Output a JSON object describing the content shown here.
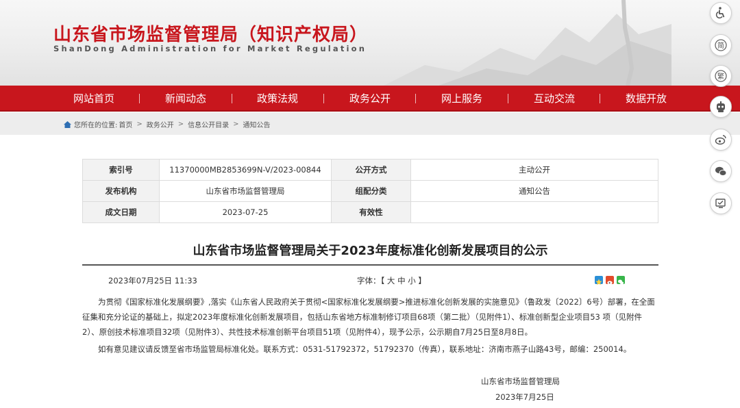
{
  "header": {
    "title": "山东省市场监督管理局（知识产权局）",
    "subtitle": "ShanDong Administration for Market Regulation"
  },
  "nav": {
    "items": [
      {
        "label": "网站首页"
      },
      {
        "label": "新闻动态"
      },
      {
        "label": "政策法规"
      },
      {
        "label": "政务公开"
      },
      {
        "label": "网上服务"
      },
      {
        "label": "互动交流"
      },
      {
        "label": "数据开放"
      }
    ]
  },
  "breadcrumb": {
    "prefix": "您所在的位置:",
    "items": [
      "首页",
      "政务公开",
      "信息公开目录",
      "通知公告"
    ],
    "separator": ">"
  },
  "info_table": {
    "index_label": "索引号",
    "index_value": "11370000MB2853699N-V/2023-00844",
    "disclosure_label": "公开方式",
    "disclosure_value": "主动公开",
    "publisher_label": "发布机构",
    "publisher_value": "山东省市场监督管理局",
    "category_label": "组配分类",
    "category_value": "通知公告",
    "date_label": "成文日期",
    "date_value": "2023-07-25",
    "validity_label": "有效性",
    "validity_value": ""
  },
  "article": {
    "title": "山东省市场监督管理局关于2023年度标准化创新发展项目的公示",
    "datetime": "2023年07月25日 11:33",
    "font_label": "字体：",
    "font_open": "【",
    "font_large": "大",
    "font_medium": "中",
    "font_small": "小",
    "font_close": "】",
    "paragraph1": "为贯彻《国家标准化发展纲要》,落实《山东省人民政府关于贯彻<国家标准化发展纲要>推进标准化创新发展的实施意见》（鲁政发〔2022〕6号）部署，在全面征集和充分论证的基础上，拟定2023年度标准化创新发展项目，包括山东省地方标准制修订项目68项（第二批）（见附件1）、标准创新型企业项目53 项（见附件2）、原创技术标准项目32项（见附件3）、共性技术标准创新平台项目51项（见附件4），现予公示，公示期自7月25日至8月8日。",
    "paragraph2": "如有意见建议请反馈至省市场监管局标准化处。联系方式：0531-51792372，51792370（传真），联系地址：济南市燕子山路43号，邮编：250014。",
    "signature": "山东省市场监督管理局",
    "sign_date": "2023年7月25日"
  },
  "side_toolbar": {
    "simplified_label": "简",
    "traditional_label": "繁"
  },
  "colors": {
    "brand_red": "#c8161d",
    "nav_text": "#ffffff",
    "table_label_bg": "#f2f2f2"
  },
  "icons": [
    "accessibility-icon",
    "simplified-chinese-icon",
    "traditional-chinese-icon",
    "robot-icon",
    "weibo-icon",
    "wechat-icon",
    "app-icon",
    "home-icon"
  ]
}
